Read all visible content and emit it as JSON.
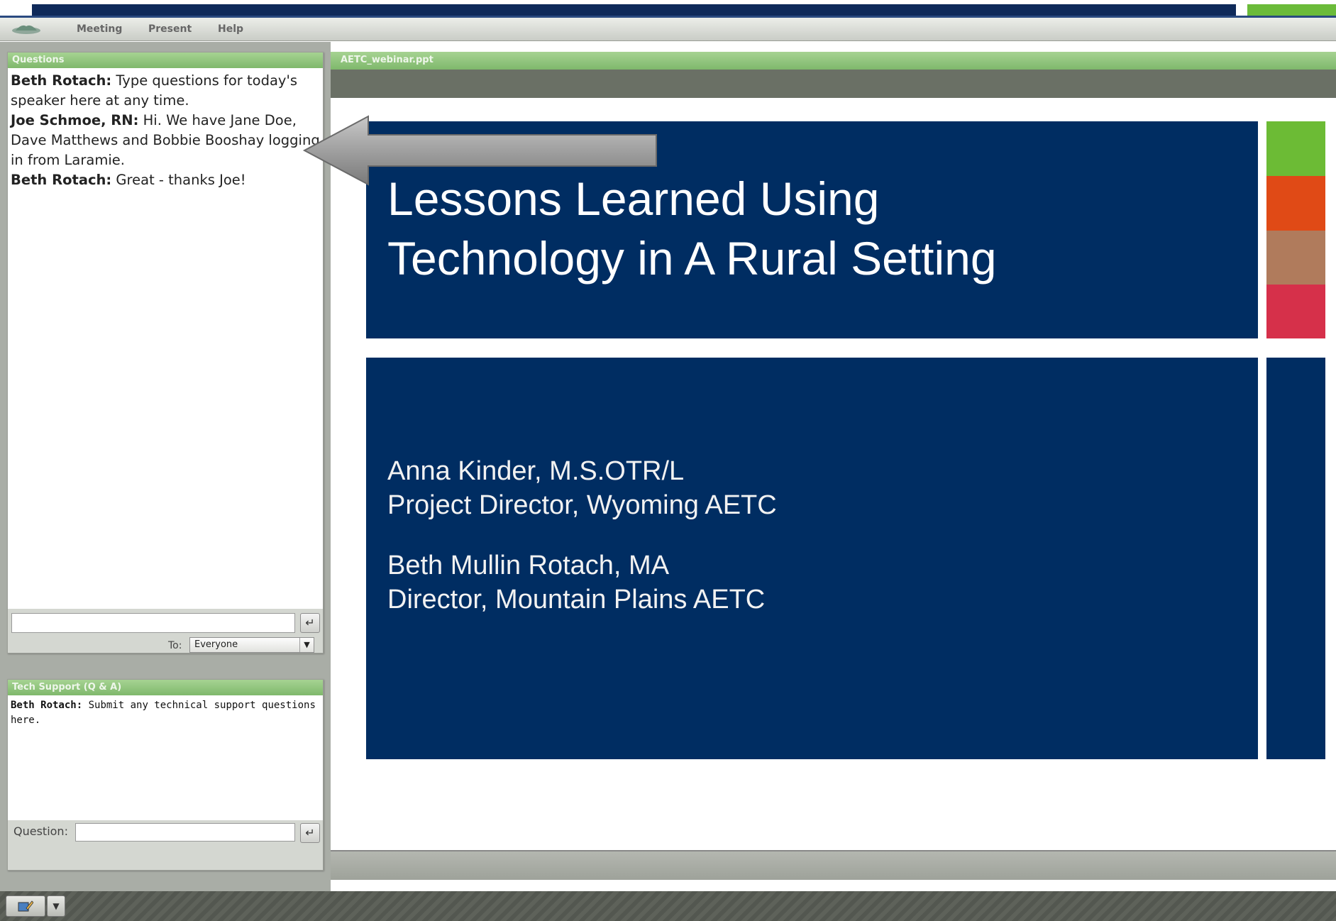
{
  "menu": {
    "items": [
      "Meeting",
      "Present",
      "Help"
    ]
  },
  "questions_panel": {
    "title": "Questions",
    "messages": [
      {
        "author": "Beth Rotach:",
        "text": " Type questions for today's speaker here at any time."
      },
      {
        "author": "Joe Schmoe, RN:",
        "text": " Hi. We have Jane Doe, Dave Matthews and Bobbie Booshay logging in from Laramie."
      },
      {
        "author": "Beth Rotach:",
        "text": " Great - thanks Joe!"
      }
    ],
    "input_value": "",
    "to_label": "To:",
    "to_selected": "Everyone"
  },
  "tech_support_panel": {
    "title": "Tech Support (Q & A)",
    "messages": [
      {
        "author": "Beth Rotach:",
        "text": " Submit any technical support questions here."
      }
    ],
    "question_label": "Question:",
    "input_value": ""
  },
  "presentation": {
    "file_name": "AETC_webinar.ppt",
    "title": "Lessons Learned Using Technology in A Rural Setting",
    "title_lines": [
      "Lessons Learned Using",
      "Technology in A Rural Setting"
    ],
    "presenters": [
      {
        "name": "Anna Kinder, M.S.OTR/L",
        "role": "Project Director, Wyoming AETC"
      },
      {
        "name": "Beth Mullin Rotach, MA",
        "role": "Director, Mountain Plains AETC"
      }
    ],
    "stripe_colors": [
      "#6cbb35",
      "#e04a16",
      "#b07b5c",
      "#d6304a"
    ]
  },
  "colors": {
    "slide_navy": "#002d62",
    "panel_green": "#7fb86c",
    "arrow_gray": "#9a9a9a"
  },
  "icons": {
    "enter": "enter-icon",
    "dropdown": "chevron-down-icon",
    "app_logo": "app-logo-icon"
  }
}
